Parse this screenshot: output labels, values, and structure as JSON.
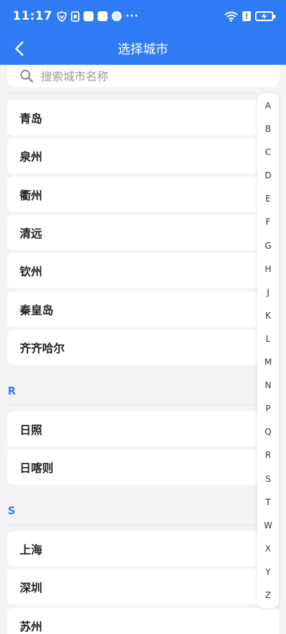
{
  "status_bar": {
    "time": "11:17",
    "more": "···",
    "alert": "!"
  },
  "header": {
    "title": "选择城市",
    "brand_color": "#2f7bf6"
  },
  "search": {
    "placeholder": "搜索城市名称"
  },
  "groups": [
    {
      "letter": "",
      "cities": [
        "青岛",
        "泉州",
        "衢州",
        "清远",
        "钦州",
        "秦皇岛",
        "齐齐哈尔"
      ]
    },
    {
      "letter": "R",
      "cities": [
        "日照",
        "日喀则"
      ]
    },
    {
      "letter": "S",
      "cities": [
        "上海",
        "深圳",
        "苏州"
      ]
    }
  ],
  "index_letters": [
    "A",
    "B",
    "C",
    "D",
    "E",
    "F",
    "G",
    "H",
    "J",
    "K",
    "L",
    "M",
    "N",
    "P",
    "Q",
    "R",
    "S",
    "T",
    "W",
    "X",
    "Y",
    "Z"
  ]
}
